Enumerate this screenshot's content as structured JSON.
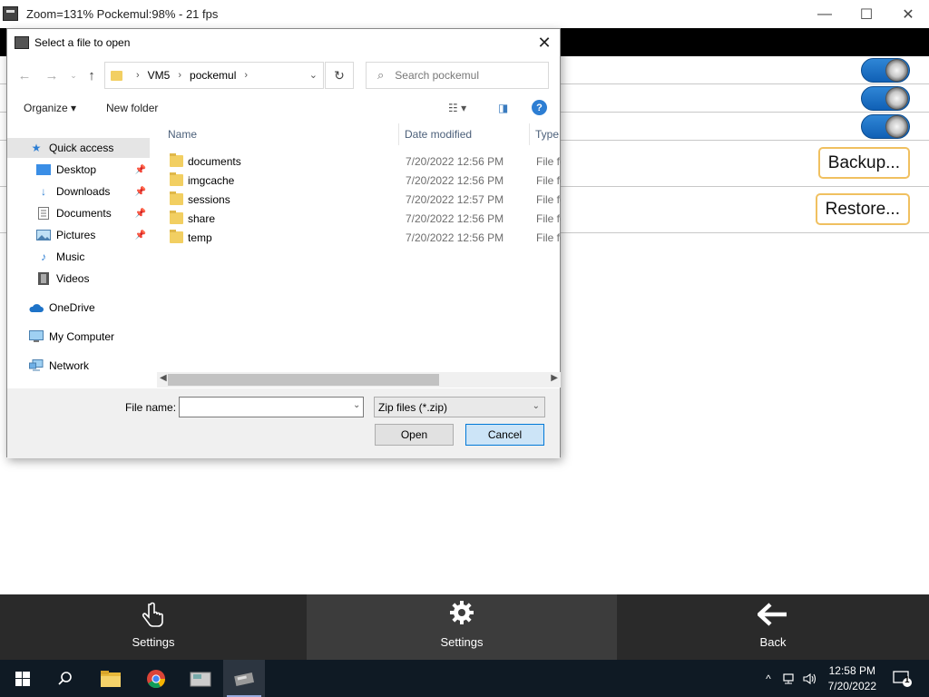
{
  "app": {
    "title": "Zoom=131%  Pockemul:98%  - 21 fps",
    "minimize": "—",
    "maximize": "☐",
    "close": "✕"
  },
  "settings": {
    "backup_label": "Backup...",
    "restore_label": "Restore..."
  },
  "bottom_nav": [
    {
      "label": "Settings",
      "icon": "hand-pointer-icon"
    },
    {
      "label": "Settings",
      "icon": "gear-icon"
    },
    {
      "label": "Back",
      "icon": "back-arrow-icon"
    }
  ],
  "dialog": {
    "title": "Select a file to open",
    "close": "✕",
    "path": [
      "VM5",
      "pockemul"
    ],
    "search_placeholder": "Search pockemul",
    "organize": "Organize ▾",
    "new_folder": "New folder",
    "help": "?",
    "nav": [
      {
        "label": "Quick access",
        "icon": "star-icon",
        "pinned": false,
        "selected": true
      },
      {
        "label": "Desktop",
        "icon": "desktop-icon",
        "pinned": true
      },
      {
        "label": "Downloads",
        "icon": "download-icon",
        "pinned": true
      },
      {
        "label": "Documents",
        "icon": "documents-icon",
        "pinned": true
      },
      {
        "label": "Pictures",
        "icon": "pictures-icon",
        "pinned": true
      },
      {
        "label": "Music",
        "icon": "music-icon",
        "pinned": false
      },
      {
        "label": "Videos",
        "icon": "videos-icon",
        "pinned": false
      },
      {
        "label": "OneDrive",
        "icon": "cloud-icon",
        "pinned": false
      },
      {
        "label": "My Computer",
        "icon": "computer-icon",
        "pinned": false
      },
      {
        "label": "Network",
        "icon": "network-icon",
        "pinned": false
      }
    ],
    "columns": {
      "name": "Name",
      "date": "Date modified",
      "type": "Type"
    },
    "files": [
      {
        "name": "documents",
        "date": "7/20/2022 12:56 PM",
        "type": "File fo"
      },
      {
        "name": "imgcache",
        "date": "7/20/2022 12:56 PM",
        "type": "File fo"
      },
      {
        "name": "sessions",
        "date": "7/20/2022 12:57 PM",
        "type": "File fo"
      },
      {
        "name": "share",
        "date": "7/20/2022 12:56 PM",
        "type": "File fo"
      },
      {
        "name": "temp",
        "date": "7/20/2022 12:56 PM",
        "type": "File fo"
      }
    ],
    "file_name_label": "File name:",
    "file_name_value": "",
    "file_type": "Zip files (*.zip)",
    "open_label": "Open",
    "cancel_label": "Cancel"
  },
  "taskbar": {
    "time": "12:58 PM",
    "date": "7/20/2022",
    "notification_count": "1"
  }
}
